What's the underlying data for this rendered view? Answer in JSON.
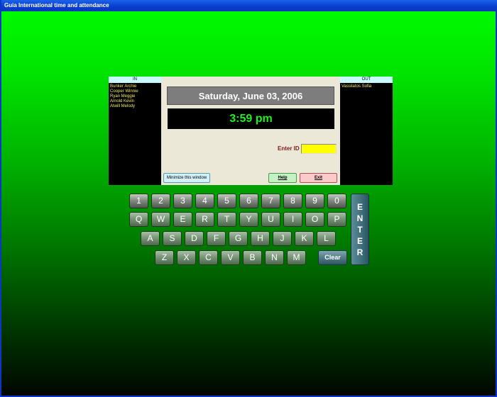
{
  "window": {
    "title": "Guia International time and attendance"
  },
  "in_list": {
    "header": "IN",
    "names": [
      "Bunker Archie",
      "Cooper Winnie",
      "Ryan Meggie",
      "Arnold Kevin",
      "Atwill Melody"
    ]
  },
  "out_list": {
    "header": "OUT",
    "names": [
      "Vassilatos Sofia"
    ]
  },
  "clock": {
    "date": "Saturday, June 03, 2006",
    "time": "3:59 pm"
  },
  "id_entry": {
    "label": "Enter ID",
    "value": ""
  },
  "buttons": {
    "minimize": "Minimize this window",
    "help": "Help",
    "exit": "Exit"
  },
  "keyboard": {
    "row1": [
      "1",
      "2",
      "3",
      "4",
      "5",
      "6",
      "7",
      "8",
      "9",
      "0"
    ],
    "row2": [
      "Q",
      "W",
      "E",
      "R",
      "T",
      "Y",
      "U",
      "I",
      "O",
      "P"
    ],
    "row3": [
      "A",
      "S",
      "D",
      "F",
      "G",
      "H",
      "J",
      "K",
      "L"
    ],
    "row4": [
      "Z",
      "X",
      "C",
      "V",
      "B",
      "N",
      "M"
    ],
    "clear": "Clear",
    "enter": "ENTER"
  },
  "colors": {
    "accent_green": "#00ff00",
    "id_field": "#ffff00",
    "time_text": "#1ef01e",
    "name_text": "#f2e96a"
  }
}
